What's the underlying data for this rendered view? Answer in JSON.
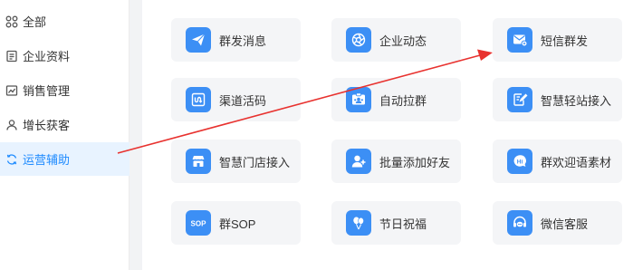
{
  "sidebar": {
    "items": [
      {
        "label": "全部",
        "icon": "grid-icon"
      },
      {
        "label": "企业资料",
        "icon": "document-icon"
      },
      {
        "label": "销售管理",
        "icon": "chart-icon"
      },
      {
        "label": "增长获客",
        "icon": "user-icon"
      },
      {
        "label": "运营辅助",
        "icon": "refresh-icon",
        "active": true
      }
    ]
  },
  "features": {
    "items": [
      {
        "label": "群发消息",
        "icon": "send-icon"
      },
      {
        "label": "企业动态",
        "icon": "aperture-icon"
      },
      {
        "label": "短信群发",
        "icon": "sms-icon"
      },
      {
        "label": "渠道活码",
        "icon": "channel-code-icon"
      },
      {
        "label": "自动拉群",
        "icon": "group-invite-icon"
      },
      {
        "label": "智慧轻站接入",
        "icon": "site-edit-icon"
      },
      {
        "label": "智慧门店接入",
        "icon": "store-icon"
      },
      {
        "label": "批量添加好友",
        "icon": "add-friend-icon"
      },
      {
        "label": "群欢迎语素材",
        "icon": "hi-bubble-icon"
      },
      {
        "label": "群SOP",
        "icon": "sop-icon",
        "icon_text": "SOP"
      },
      {
        "label": "节日祝福",
        "icon": "balloon-icon"
      },
      {
        "label": "微信客服",
        "icon": "headset-icon"
      }
    ]
  },
  "colors": {
    "accent": "#1e8bff",
    "icon_bg": "#3c8ff5",
    "arrow": "#e8322f"
  }
}
